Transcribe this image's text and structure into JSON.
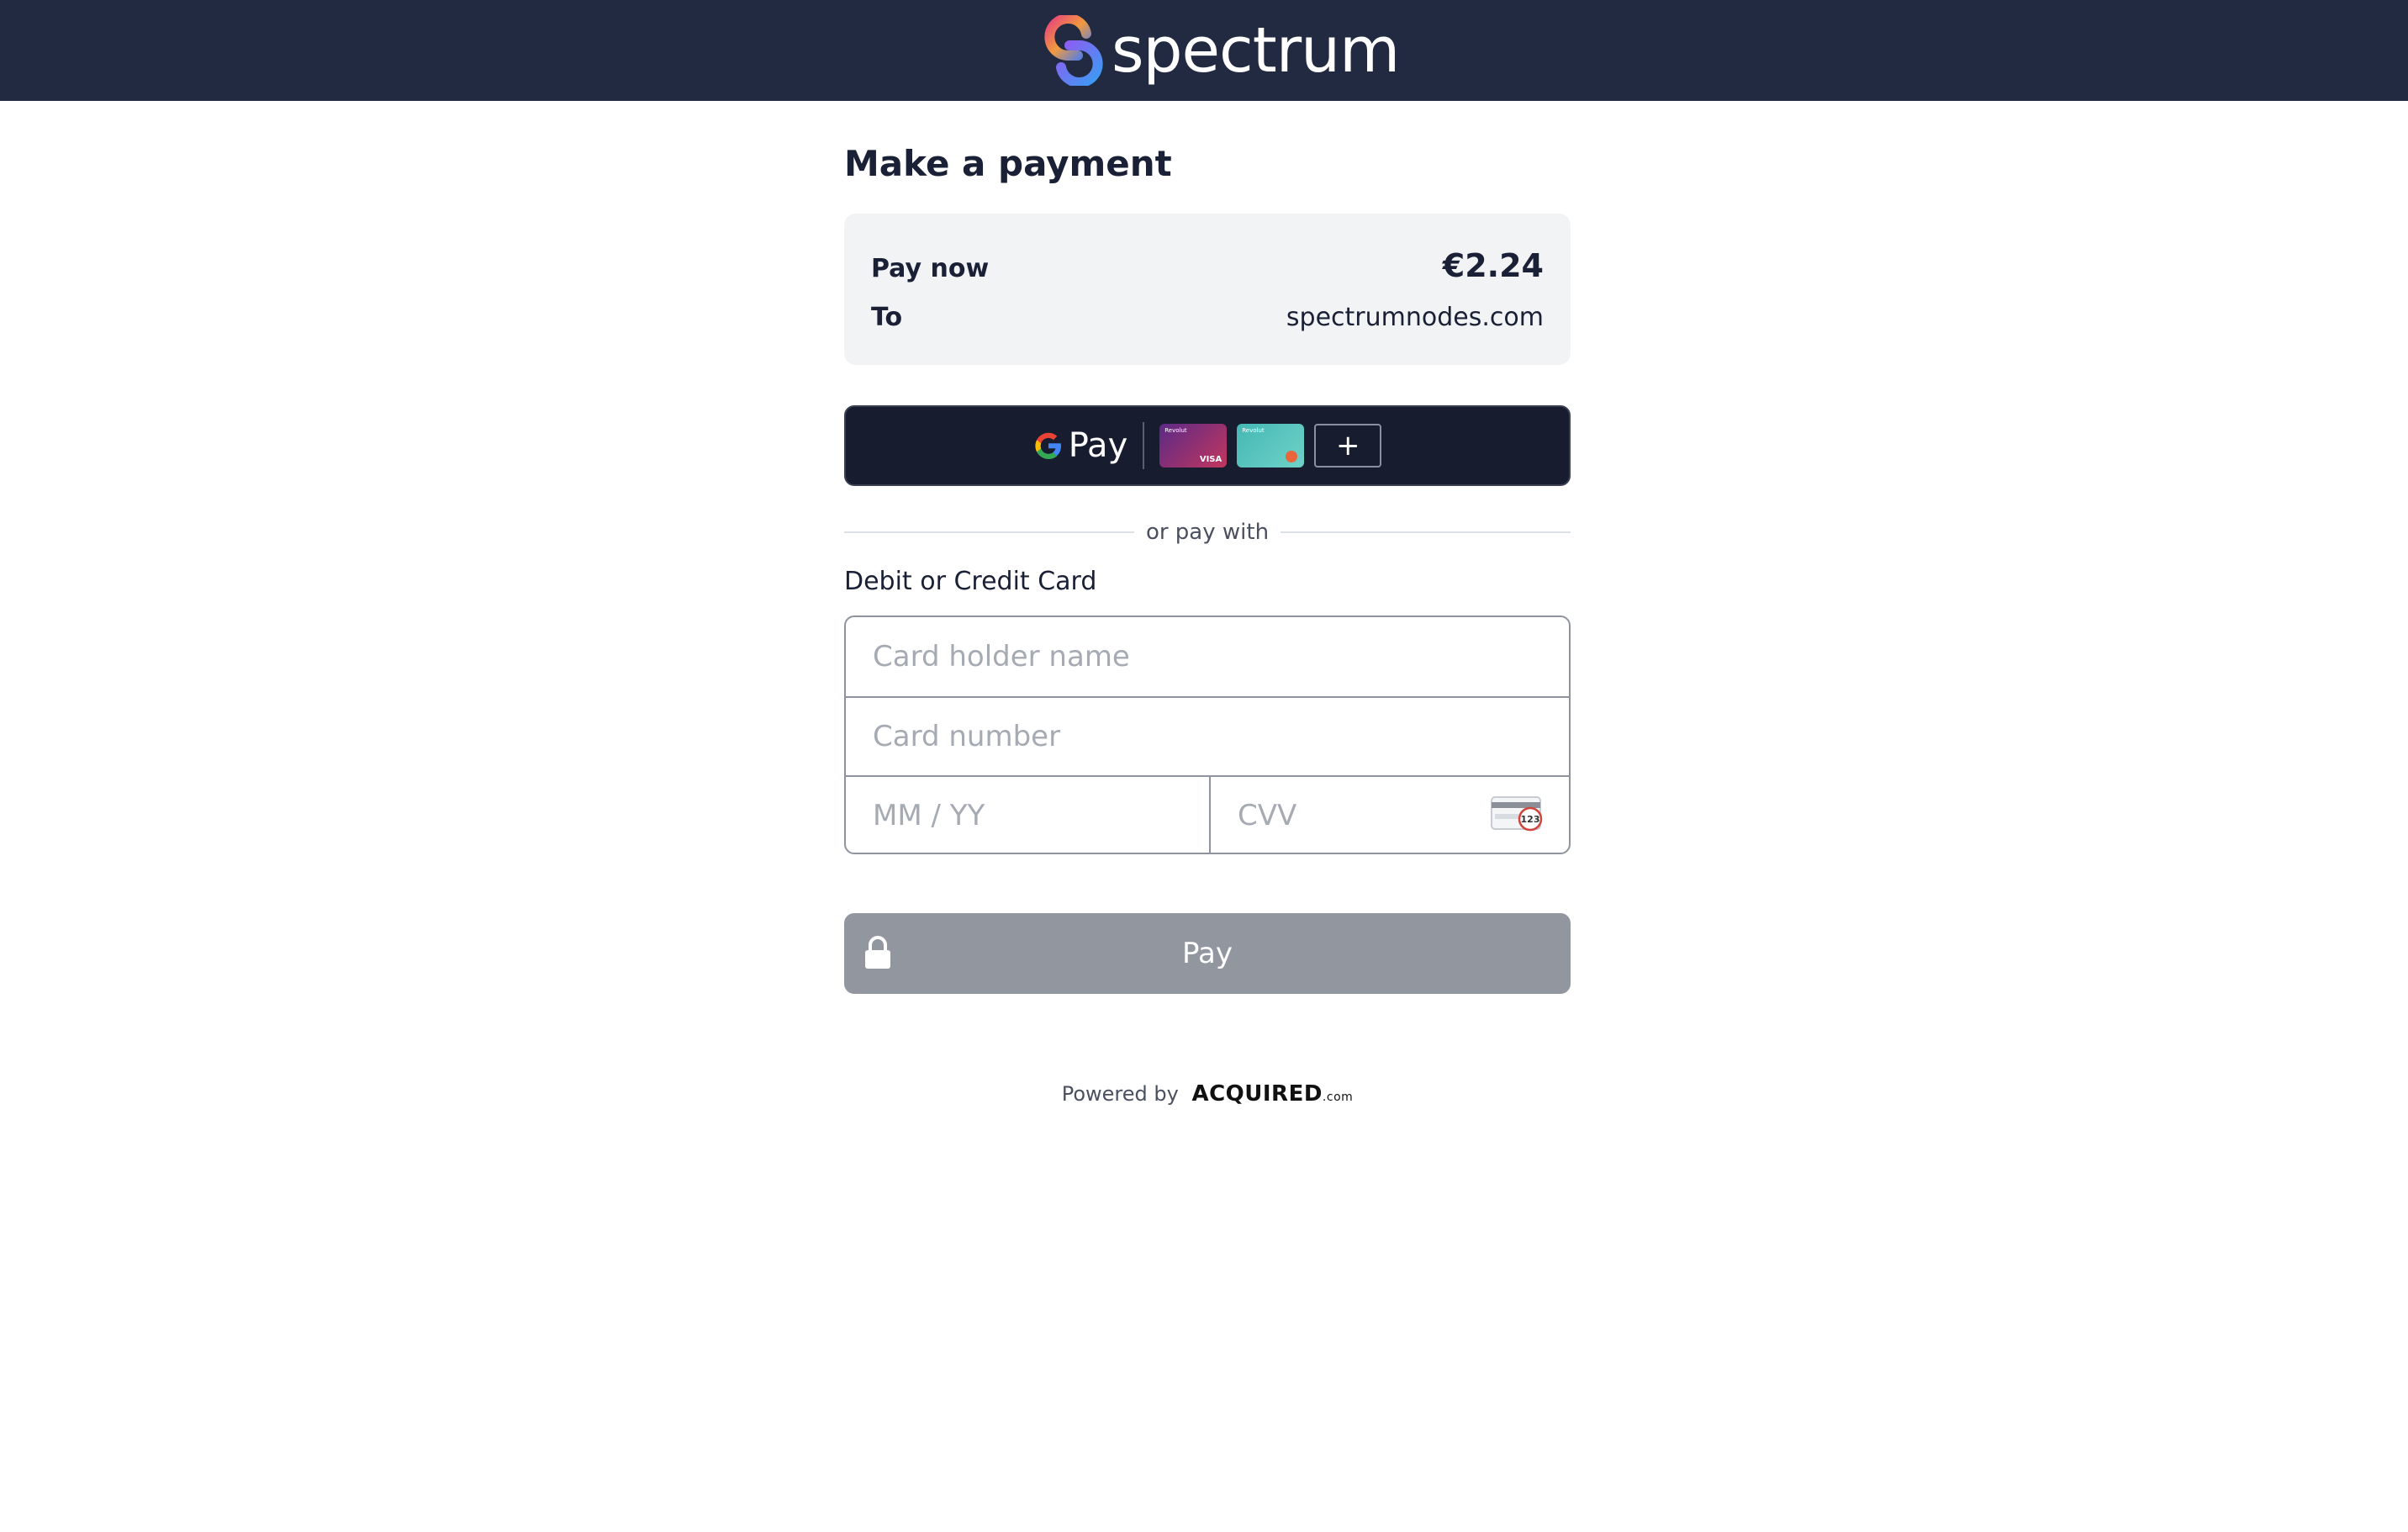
{
  "header": {
    "brand_name": "spectrum",
    "background": "#212a41"
  },
  "page": {
    "title": "Make a payment"
  },
  "summary": {
    "pay_now_label": "Pay now",
    "amount": "€2.24",
    "to_label": "To",
    "payee": "spectrumnodes.com"
  },
  "google_pay": {
    "label": "Pay",
    "card_brand_1": "VISA",
    "card_issuer": "Revolut",
    "add_label": "+"
  },
  "divider": {
    "text": "or pay with"
  },
  "card_section": {
    "label": "Debit or Credit Card",
    "cardholder_placeholder": "Card holder name",
    "card_number_placeholder": "Card number",
    "expiry_placeholder": "MM / YY",
    "cvv_placeholder": "CVV",
    "cvv_hint": "123"
  },
  "pay_button": {
    "label": "Pay",
    "icon": "lock-icon",
    "color": "#91969f"
  },
  "footer": {
    "powered_by": "Powered by",
    "provider": "ACQUIRED",
    "provider_suffix": ".com"
  }
}
